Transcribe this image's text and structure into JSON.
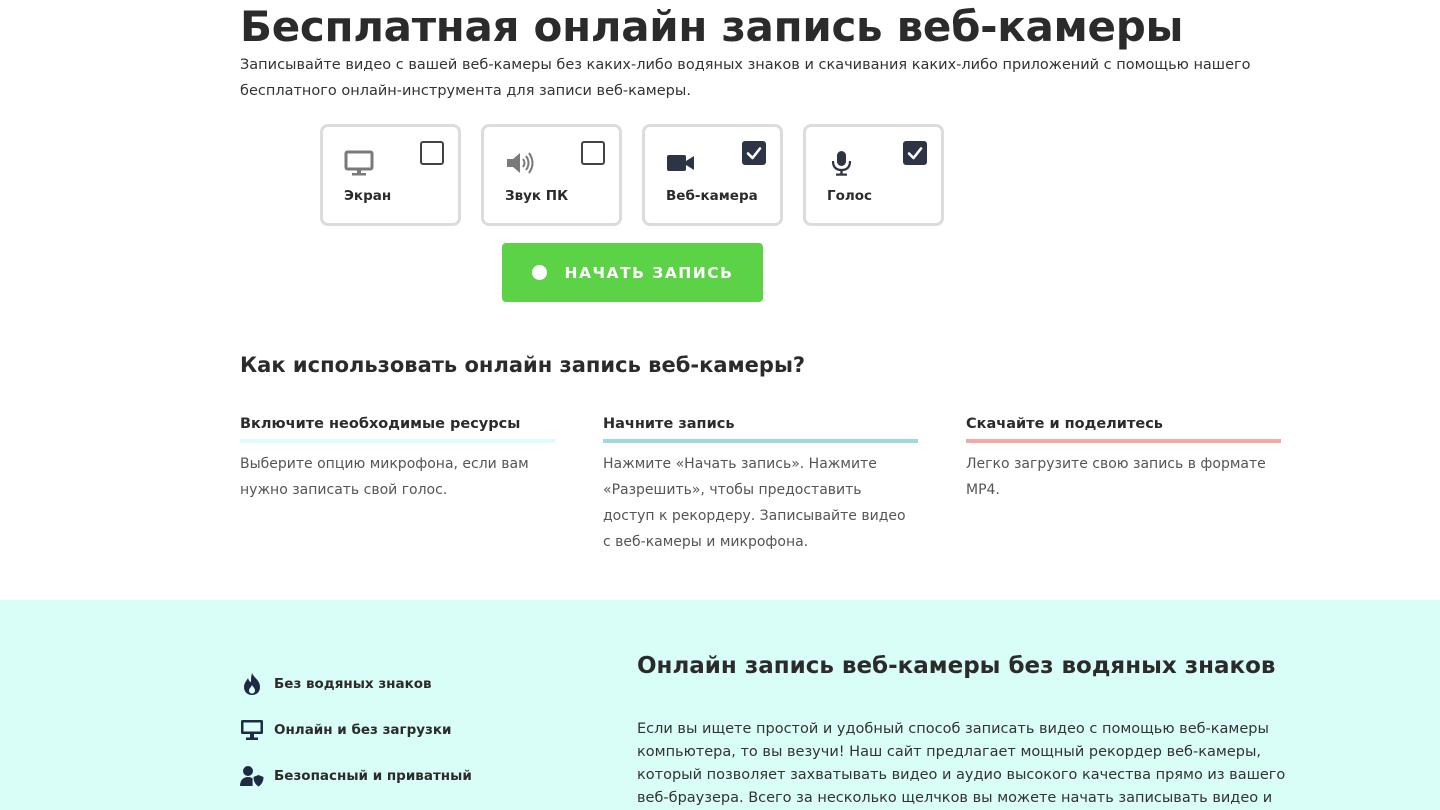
{
  "header": {
    "title": "Бесплатная онлайн запись веб-камеры",
    "subtitle": "Записывайте видео с вашей веб-камеры без каких-либо водяных знаков и скачивания каких-либо приложений с помощью нашего бесплатного онлайн-инструмента для записи веб-камеры."
  },
  "options": [
    {
      "label": "Экран",
      "icon": "monitor-icon",
      "checked": false
    },
    {
      "label": "Звук ПК",
      "icon": "speaker-icon",
      "checked": false
    },
    {
      "label": "Веб-камера",
      "icon": "video-camera-icon",
      "checked": true
    },
    {
      "label": "Голос",
      "icon": "microphone-icon",
      "checked": true
    }
  ],
  "start_button": {
    "label": "НАЧАТЬ ЗАПИСЬ"
  },
  "how_to": {
    "title": "Как использовать онлайн запись веб-камеры?",
    "steps": [
      {
        "title": "Включите необходимые ресурсы",
        "text": "Выберите опцию микрофона, если вам нужно записать свой голос."
      },
      {
        "title": "Начните запись",
        "text": "Нажмите «Начать запись». Нажмите «Разрешить», чтобы предоставить доступ к рекордеру. Записывайте видео с веб-камеры и микрофона."
      },
      {
        "title": "Скачайте и поделитесь",
        "text": "Легко загрузите свою запись в формате MP4."
      }
    ]
  },
  "features": [
    {
      "label": "Без водяных знаков",
      "icon": "flame-icon"
    },
    {
      "label": "Онлайн и без загрузки",
      "icon": "monitor-icon"
    },
    {
      "label": "Безопасный и приватный",
      "icon": "user-shield-icon"
    }
  ],
  "info": {
    "title": "Онлайн запись веб-камеры без водяных знаков",
    "text": "Если вы ищете простой и удобный способ записать видео с помощью веб-камеры компьютера, то вы везучи! Наш сайт предлагает мощный рекордер веб-камеры, который позволяет захватывать видео и аудио высокого качества прямо из вашего веб-браузера. Всего за несколько щелчков вы можете начать записывать видео и сохранить его на свой"
  },
  "colors": {
    "accent_green": "#5cd346",
    "checkbox_dark": "#2d3445",
    "band_bg": "#d9fdf7"
  }
}
